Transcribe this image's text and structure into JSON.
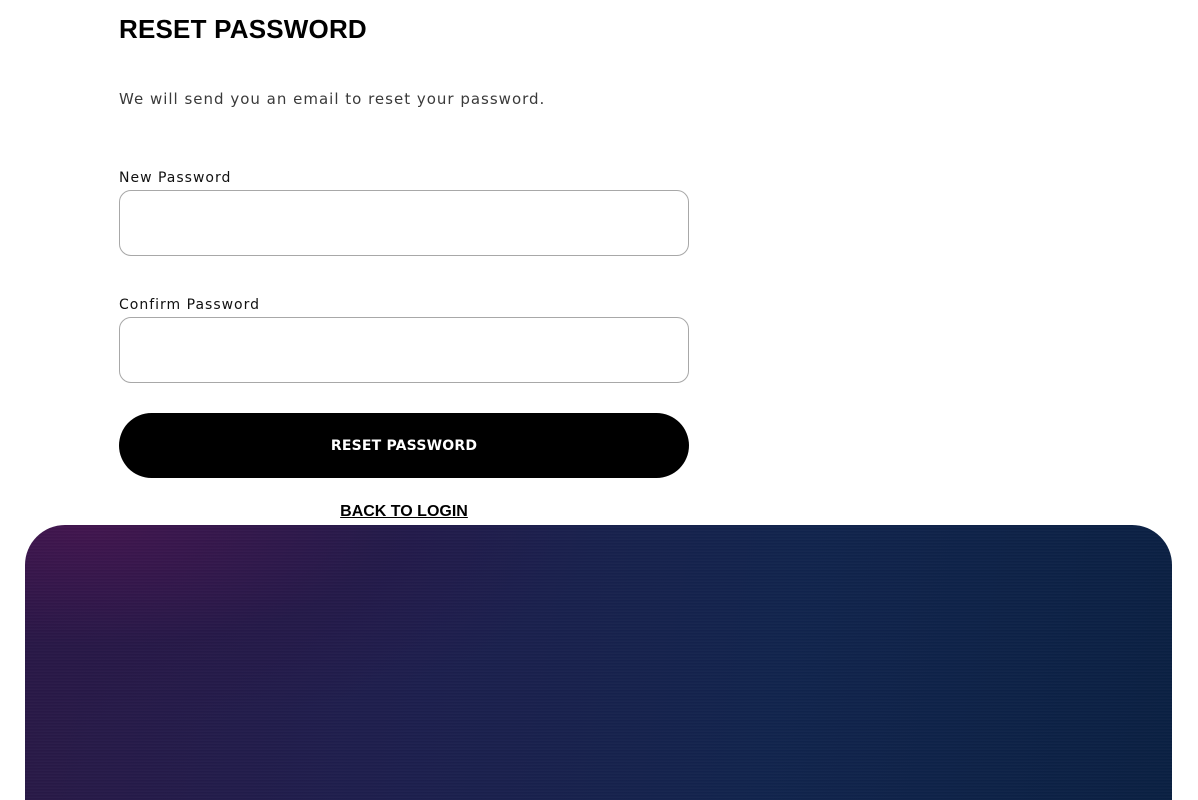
{
  "reset_form": {
    "title": "RESET PASSWORD",
    "subtitle": "We will send you an email to reset your password.",
    "new_password": {
      "label": "New Password",
      "value": "",
      "placeholder": ""
    },
    "confirm_password": {
      "label": "Confirm Password",
      "value": "",
      "placeholder": ""
    },
    "submit_label": "RESET PASSWORD",
    "back_link_label": "BACK TO LOGIN"
  },
  "colors": {
    "button_bg": "#000000",
    "button_text": "#ffffff",
    "field_border": "#a8a8a8",
    "banner_gradient_start": "#2a1846",
    "banner_gradient_end": "#0a2042"
  }
}
